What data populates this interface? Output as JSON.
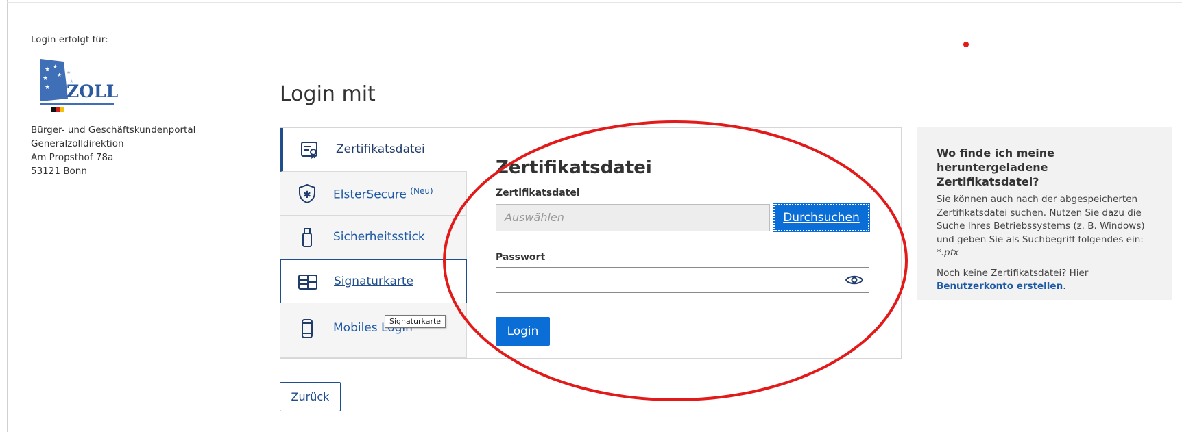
{
  "org": {
    "caption": "Login erfolgt für:",
    "logo_text": "ZOLL",
    "lines": [
      "Bürger- und Geschäftskundenportal",
      "Generalzolldirektion",
      "Am Propsthof 78a",
      "53121 Bonn"
    ]
  },
  "page_title": "Login mit",
  "tabs": [
    {
      "label": "Zertifikatsdatei",
      "icon": "certificate-file-icon",
      "state": "active"
    },
    {
      "label": "ElsterSecure",
      "sup": "(Neu)",
      "icon": "elster-secure-shield-icon"
    },
    {
      "label": "Sicherheitsstick",
      "icon": "usb-stick-icon"
    },
    {
      "label": "Signaturkarte",
      "icon": "signature-card-icon",
      "state": "hover"
    },
    {
      "label": "Mobiles Login",
      "icon": "mobile-phone-icon"
    }
  ],
  "tooltip": "Signaturkarte",
  "form": {
    "title": "Zertifikatsdatei",
    "file_label": "Zertifikatsdatei",
    "file_placeholder": "Auswählen",
    "browse_label": "Durchsuchen",
    "password_label": "Passwort",
    "login_label": "Login"
  },
  "help": {
    "title": "Wo finde ich meine heruntergeladene Zertifikatsdatei?",
    "text": "Sie können auch nach der abgespeicherten Zertifikatsdatei suchen. Nutzen Sie dazu die Suche Ihres Betriebssystems (z. B. Windows) und geben Sie als Suchbegriff folgendes ein:",
    "pattern": "*.pfx",
    "text2": "Noch keine Zertifikatsdatei? Hier",
    "link": "Benutzerkonto erstellen",
    "period": "."
  },
  "back_label": "Zurück",
  "colors": {
    "primary": "#0a6ed6",
    "navy": "#1f4e8c",
    "link": "#1f5aa6",
    "annotation": "#e21a1a"
  }
}
